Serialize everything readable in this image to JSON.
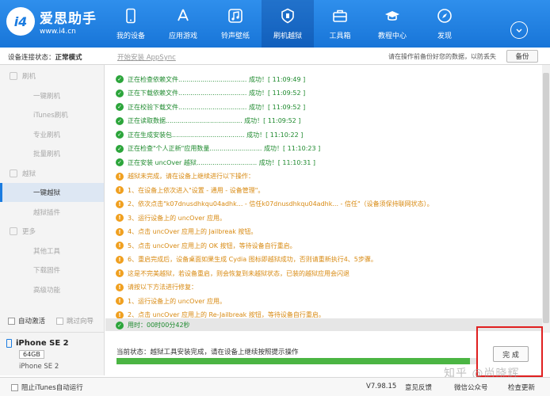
{
  "app": {
    "logo_letters": "i4",
    "name": "爱思助手",
    "url": "www.i4.cn"
  },
  "nav": [
    {
      "label": "我的设备",
      "icon": "phone-icon"
    },
    {
      "label": "应用游戏",
      "icon": "appstore-icon"
    },
    {
      "label": "铃声壁纸",
      "icon": "music-icon"
    },
    {
      "label": "刷机越狱",
      "icon": "flash-icon",
      "active": true
    },
    {
      "label": "工具箱",
      "icon": "toolbox-icon"
    },
    {
      "label": "教程中心",
      "icon": "graduation-cap-icon"
    },
    {
      "label": "发现",
      "icon": "compass-icon"
    }
  ],
  "statusbar": {
    "conn_label": "设备连接状态：",
    "conn_value": "正常模式",
    "appsync": "开始安装 AppSync",
    "backup_hint": "请在操作前备份好您的数据，以防丢失",
    "backup_button": "备份"
  },
  "sidebar": {
    "groups": [
      {
        "label": "刷机",
        "items": [
          "一键刷机",
          "iTunes刷机",
          "专业刷机",
          "批量刷机"
        ]
      },
      {
        "label": "越狱",
        "items": [
          "一键越狱",
          "越狱插件"
        ]
      },
      {
        "label": "更多",
        "items": [
          "其他工具",
          "下载固件",
          "高级功能"
        ]
      }
    ],
    "active_item": "一键越狱",
    "auto_activate": "自动激活",
    "skip_guide": "跳过向导"
  },
  "device": {
    "name": "iPhone SE 2",
    "capacity": "64GB",
    "model": "iPhone SE 2"
  },
  "log": [
    {
      "type": "ok",
      "text": "正在检查依赖文件.................................. 成功！[ 11:09:49 ]"
    },
    {
      "type": "ok",
      "text": "正在下载依赖文件.................................. 成功！[ 11:09:52 ]"
    },
    {
      "type": "ok",
      "text": "正在校验下载文件.................................. 成功！[ 11:09:52 ]"
    },
    {
      "type": "ok",
      "text": "正在读取数据...................................... 成功！[ 11:09:52 ]"
    },
    {
      "type": "ok",
      "text": "正在生成安装包.................................... 成功！[ 11:10:22 ]"
    },
    {
      "type": "ok",
      "text": "正在检查\"个人正新\"应用数量.......................... 成功！[ 11:10:23 ]"
    },
    {
      "type": "ok",
      "text": "正在安装 uncOver 越狱.............................. 成功！[ 11:10:31 ]"
    },
    {
      "type": "warn",
      "text": "越狱未完成，请在设备上继续进行以下操作："
    },
    {
      "type": "warn",
      "text": "1、在设备上依次进入\"设置 - 通用 - 设备管理\"。"
    },
    {
      "type": "warn",
      "text": "2、依次点击\"k07dnusdhkqu04adhk... - 信任k07dnusdhkqu04adhk... - 信任\"（设备须保持联网状态）。"
    },
    {
      "type": "warn",
      "text": "3、运行设备上的 uncOver 应用。"
    },
    {
      "type": "warn",
      "text": "4、点击 uncOver 应用上的 Jailbreak 按钮。"
    },
    {
      "type": "warn",
      "text": "5、点击 uncOver 应用上的 OK 按钮，等待设备自行重启。"
    },
    {
      "type": "warn",
      "text": "6、重启完成后，设备桌面如果生成 Cydia 图标即越狱成功，否则请重新执行4、5步骤。"
    },
    {
      "type": "warn",
      "text": "这是不完美越狱，若设备重启，则会恢复到未越狱状态，已装的越狱应用会闪退"
    },
    {
      "type": "warn",
      "text": "请按以下方法进行修复："
    },
    {
      "type": "warn",
      "text": "1、运行设备上的 uncOver 应用。"
    },
    {
      "type": "warn",
      "text": "2、点击 uncOver 应用上的 Re-Jailbreak 按钮，等待设备自行重启。"
    }
  ],
  "elapsed": "用时：00时00分42秒",
  "current_status": "当前状态：越狱工具安装完成，请在设备上继续按照提示操作",
  "progress": 0.98,
  "done_button": "完 成",
  "watermark": "知乎 @尚晓辉",
  "footer": {
    "itunes": "阻止iTunes自动运行",
    "version": "V7.98.15",
    "feedback": "意见反馈",
    "wechat": "微信公众号",
    "update": "检查更新"
  }
}
